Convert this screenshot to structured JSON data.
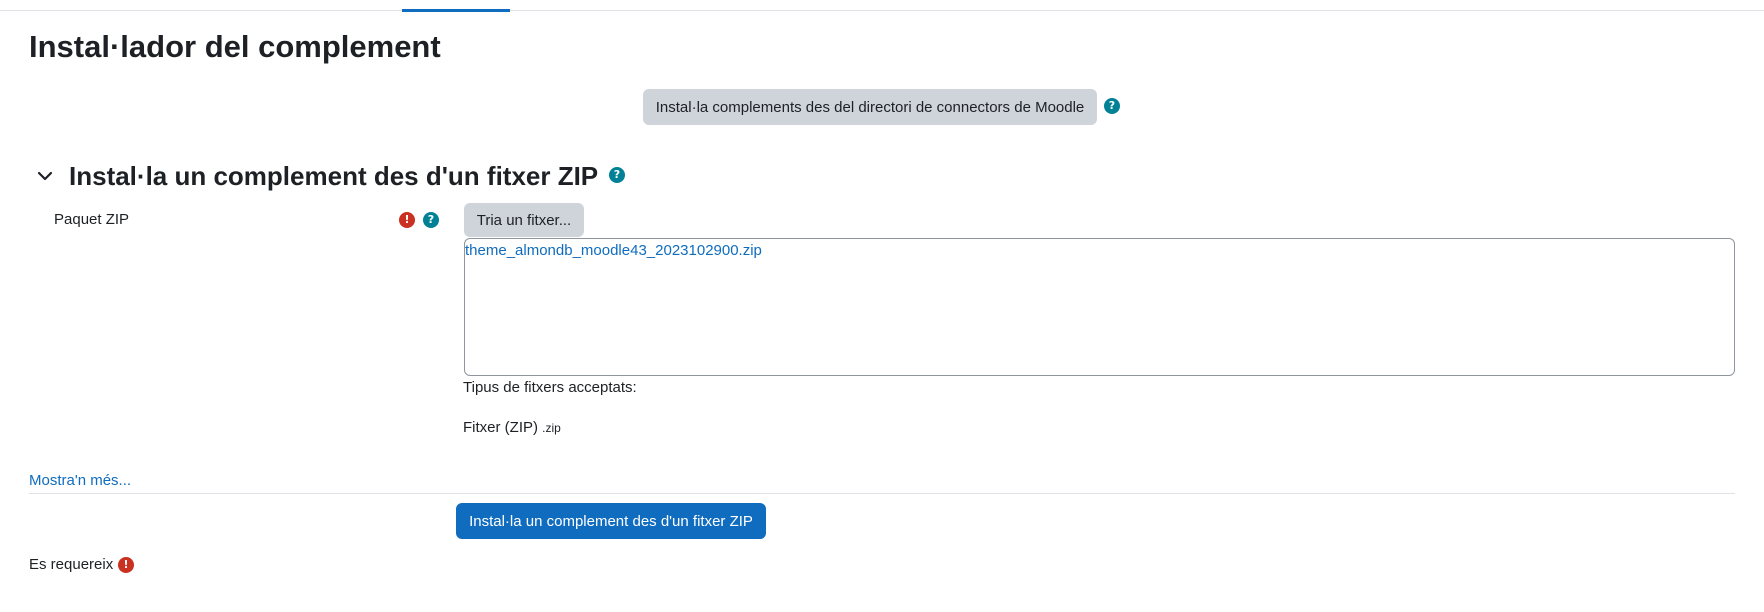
{
  "page": {
    "title": "Instal·lador del complement"
  },
  "directory_button": {
    "label": "Instal·la complements des del directori de connectors de Moodle"
  },
  "section": {
    "title": "Instal·la un complement des d'un fitxer ZIP"
  },
  "zip_field": {
    "label": "Paquet ZIP",
    "choose_button": "Tria un fitxer...",
    "selected_file": "theme_almondb_moodle43_2023102900.zip",
    "accepted_label": "Tipus de fitxers acceptats:",
    "accepted_type_name": "Fitxer (ZIP)",
    "accepted_type_ext": ".zip"
  },
  "show_more": "Mostra'n més...",
  "submit_button": "Instal·la un complement des d'un fitxer ZIP",
  "required_note": "Es requereix",
  "icons": {
    "help": "?",
    "required": "!"
  },
  "colors": {
    "primary": "#0f6cbf",
    "secondary": "#ced4da",
    "help": "#008196",
    "error": "#ca3120"
  }
}
